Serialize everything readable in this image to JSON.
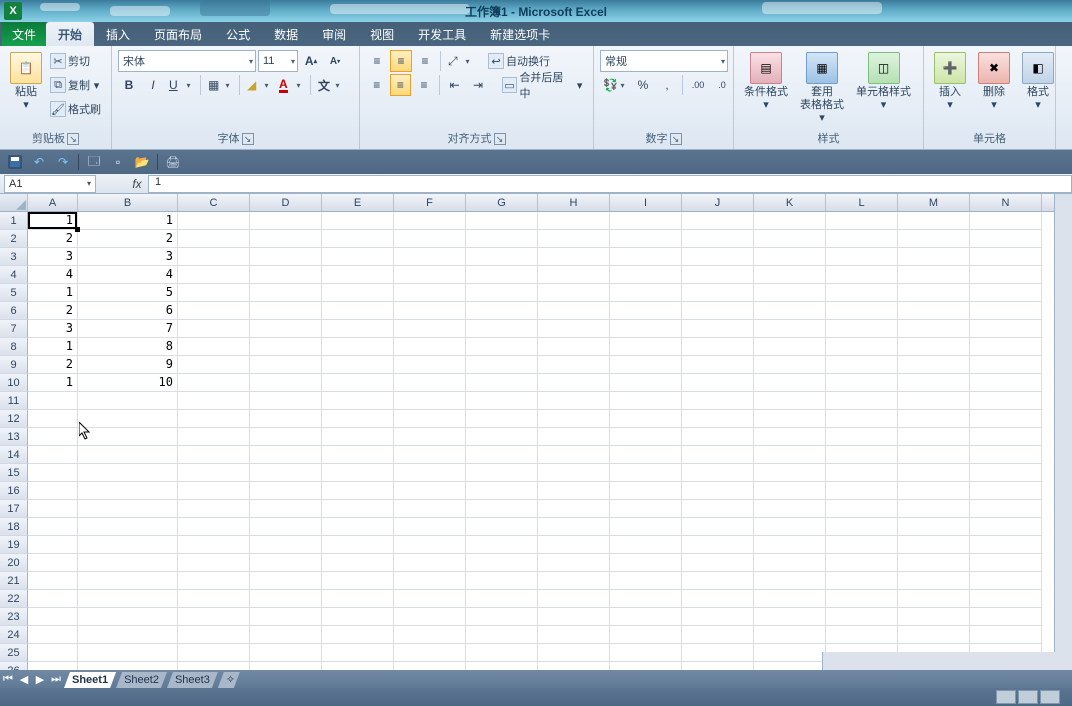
{
  "title": "工作簿1 - Microsoft Excel",
  "app_icon_letter": "X",
  "tabs": {
    "file": "文件",
    "home": "开始",
    "insert": "插入",
    "layout": "页面布局",
    "formulas": "公式",
    "data": "数据",
    "review": "审阅",
    "view": "视图",
    "dev": "开发工具",
    "custom": "新建选项卡"
  },
  "ribbon": {
    "clipboard": {
      "paste": "粘贴",
      "cut": "剪切",
      "copy": "复制",
      "painter": "格式刷",
      "label": "剪贴板"
    },
    "font": {
      "name": "宋体",
      "size": "11",
      "b": "B",
      "i": "I",
      "u": "U",
      "label": "字体",
      "grow": "A",
      "shrink": "A"
    },
    "align": {
      "wrap": "自动换行",
      "merge": "合并后居中",
      "label": "对齐方式"
    },
    "number": {
      "format": "常规",
      "label": "数字",
      "pct": "%",
      "comma": ","
    },
    "styles": {
      "cond": "条件格式",
      "table": "套用\n表格格式",
      "cell": "单元格样式",
      "label": "样式"
    },
    "cells": {
      "insert": "插入",
      "delete": "删除",
      "format": "格式",
      "label": "单元格"
    }
  },
  "namebox": "A1",
  "formula": "1",
  "columns": [
    "A",
    "B",
    "C",
    "D",
    "E",
    "F",
    "G",
    "H",
    "I",
    "J",
    "K",
    "L",
    "M",
    "N"
  ],
  "row_count": 26,
  "data_rows": [
    {
      "a": "1",
      "b": "1"
    },
    {
      "a": "2",
      "b": "2"
    },
    {
      "a": "3",
      "b": "3"
    },
    {
      "a": "4",
      "b": "4"
    },
    {
      "a": "1",
      "b": "5"
    },
    {
      "a": "2",
      "b": "6"
    },
    {
      "a": "3",
      "b": "7"
    },
    {
      "a": "1",
      "b": "8"
    },
    {
      "a": "2",
      "b": "9"
    },
    {
      "a": "1",
      "b": "10"
    }
  ],
  "sheets": [
    "Sheet1",
    "Sheet2",
    "Sheet3"
  ]
}
